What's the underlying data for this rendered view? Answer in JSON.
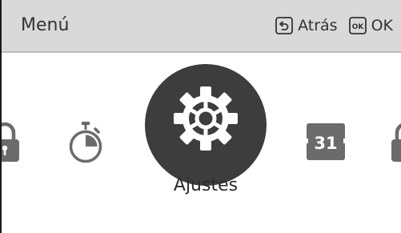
{
  "header": {
    "title": "Menú",
    "back_label": "Atrás",
    "ok_key_glyph": "OK",
    "ok_label": "OK"
  },
  "carousel": {
    "items": [
      {
        "icon": "lock-icon",
        "label": ""
      },
      {
        "icon": "timer-icon",
        "label": ""
      },
      {
        "icon": "gear-icon",
        "label": "Ajustes",
        "selected": true
      },
      {
        "icon": "calendar-icon",
        "label": ""
      },
      {
        "icon": "lock-icon",
        "label": ""
      }
    ],
    "selected_label": "Ajustes",
    "calendar_day": "31"
  },
  "colors": {
    "header_bg": "#d9d9d9",
    "icon_gray": "#6b6b6b",
    "selected_circle": "#3d3d3d",
    "text": "#333333"
  }
}
